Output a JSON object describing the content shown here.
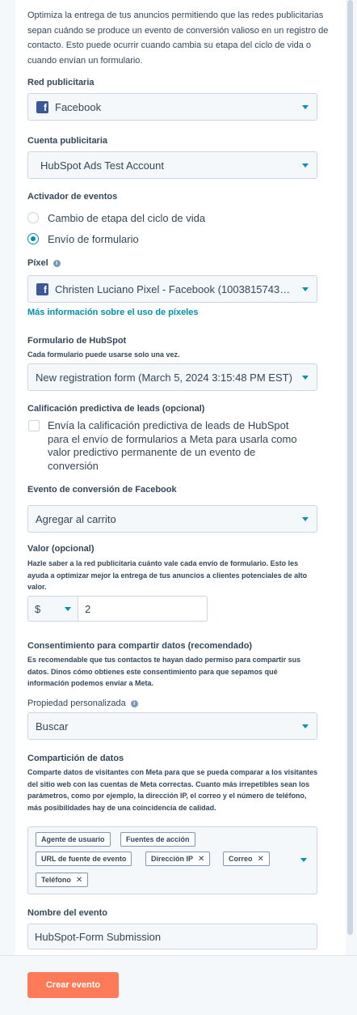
{
  "intro": "Optimiza la entrega de tus anuncios permitiendo que las redes publicitarias sepan cuándo se produce un evento de conversión valioso en un registro de contacto. Esto puede ocurrir cuando cambia su etapa del ciclo de vida o cuando envían un formulario.",
  "ad_network": {
    "label": "Red publicitaria",
    "value": "Facebook",
    "icon": "facebook-icon"
  },
  "ad_account": {
    "label": "Cuenta publicitaria",
    "value": "HubSpot Ads Test Account"
  },
  "trigger": {
    "label": "Activador de eventos",
    "options": [
      {
        "label": "Cambio de etapa del ciclo de vida",
        "selected": false
      },
      {
        "label": "Envío de formulario",
        "selected": true
      }
    ]
  },
  "pixel": {
    "label": "Píxel",
    "value": "Christen Luciano Pixel - Facebook (1003815743316...",
    "link": "Más información sobre el uso de píxeles"
  },
  "form": {
    "label": "Formulario de HubSpot",
    "help": "Cada formulario puede usarse solo una vez.",
    "value": "New registration form (March 5, 2024 3:15:48 PM EST)"
  },
  "lead_scoring": {
    "label": "Calificación predictiva de leads (opcional)",
    "checkbox_text": "Envía la calificación predictiva de leads de HubSpot para el envío de formularios a Meta para usarla como valor predictivo permanente de un evento de conversión",
    "checked": false
  },
  "conversion_event": {
    "label": "Evento de conversión de Facebook",
    "value": "Agregar al carrito"
  },
  "value": {
    "label": "Valor (opcional)",
    "help": "Hazle saber a la red publicitaria cuánto vale cada envío de formulario. Esto les ayuda a optimizar mejor la entrega de tus anuncios a clientes potenciales de alto valor.",
    "currency": "$",
    "amount": "2"
  },
  "consent": {
    "label": "Consentimiento para compartir datos (recomendado)",
    "help": "Es recomendable que tus contactos te hayan dado permiso para compartir sus datos. Dinos cómo obtienes este consentimiento para que sepamos qué información podemos enviar a Meta.",
    "property_label": "Propiedad personalizada",
    "property_value": "Buscar"
  },
  "data_sharing": {
    "label": "Compartición de datos",
    "help": "Comparte datos de visitantes con Meta para que se pueda comparar a los visitantes del sitio web con las cuentas de Meta correctas. Cuanto más irrepetibles sean los parámetros, como por ejemplo, la dirección IP, el correo y el número de teléfono, más posibilidades hay de una coincidencia de calidad.",
    "tags": [
      {
        "label": "Agente de usuario",
        "removable": false
      },
      {
        "label": "Fuentes de acción",
        "removable": false
      },
      {
        "label": "URL de fuente de evento",
        "removable": false
      },
      {
        "label": "Dirección IP",
        "removable": true
      },
      {
        "label": "Correo",
        "removable": true
      },
      {
        "label": "Teléfono",
        "removable": true
      }
    ],
    "remove_glyph": "✕"
  },
  "event_name": {
    "label": "Nombre del evento",
    "value": "HubSpot-Form Submission"
  },
  "footer": {
    "create_button": "Crear evento"
  },
  "colors": {
    "accent": "#0091ae",
    "button": "#ff7a59",
    "facebook": "#3b5998"
  }
}
